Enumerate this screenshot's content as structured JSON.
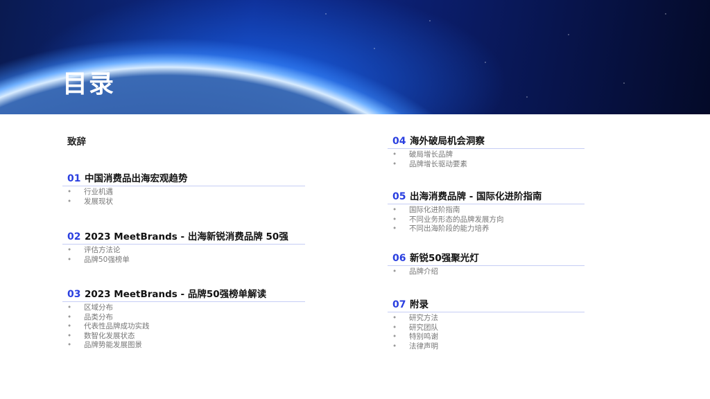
{
  "title": "目录",
  "preface": "致辞",
  "sections": [
    {
      "num": "01",
      "title": "中国消费品出海宏观趋势",
      "items": [
        "行业机遇",
        "发展现状"
      ]
    },
    {
      "num": "02",
      "title": "2023 MeetBrands - 出海新锐消费品牌 50强",
      "items": [
        "评估方法论",
        "品牌50强榜单"
      ]
    },
    {
      "num": "03",
      "title": "2023 MeetBrands - 品牌50强榜单解读",
      "items": [
        "区域分布",
        "品类分布",
        "代表性品牌成功实践",
        "数智化发展状态",
        "品牌势能发展图景"
      ]
    },
    {
      "num": "04",
      "title": "海外破局机会洞察",
      "items": [
        "破局增长品牌",
        "品牌增长驱动要素"
      ]
    },
    {
      "num": "05",
      "title": "出海消费品牌 - 国际化进阶指南",
      "items": [
        "国际化进阶指南",
        "不同业务形态的品牌发展方向",
        "不同出海阶段的能力培养"
      ]
    },
    {
      "num": "06",
      "title": "新锐50强聚光灯",
      "items": [
        "品牌介绍"
      ]
    },
    {
      "num": "07",
      "title": "附录",
      "items": [
        "研究方法",
        "研究团队",
        "特别鸣谢",
        "法律声明"
      ]
    }
  ]
}
